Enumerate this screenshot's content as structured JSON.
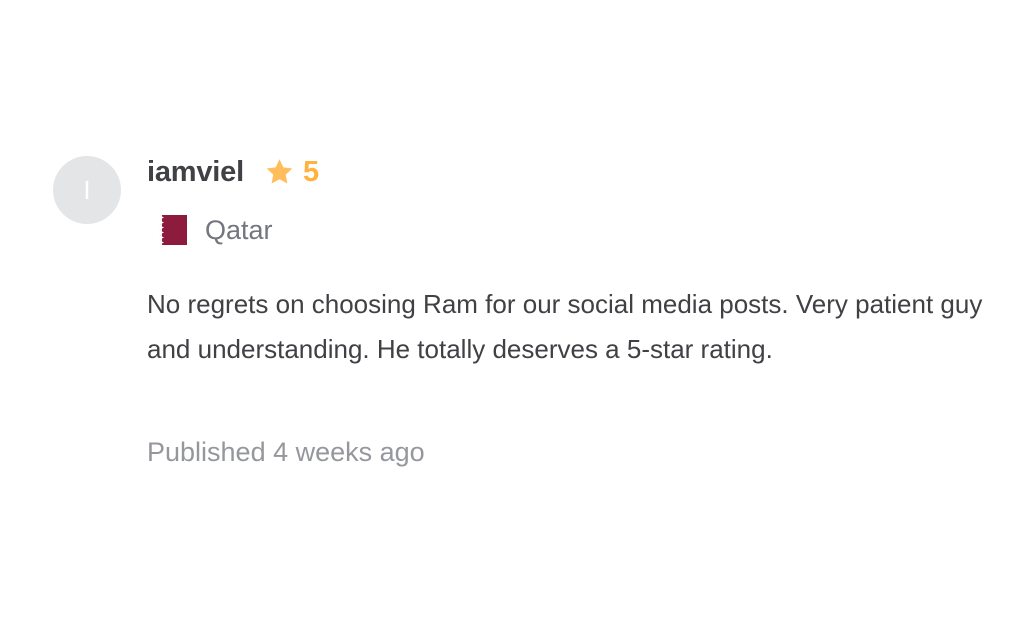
{
  "review": {
    "avatar_initial": "I",
    "username": "iamviel",
    "rating": "5",
    "rating_icon": "star-icon",
    "country": "Qatar",
    "country_flag_icon": "qatar-flag-icon",
    "text": "No regrets on choosing Ram for our social media posts. Very patient guy and understanding. He totally deserves a 5-star rating.",
    "published": "Published 4 weeks ago"
  },
  "colors": {
    "star": "#ffbe5b",
    "rating_text": "#ffb33e",
    "flag_maroon": "#8d1b3d",
    "avatar_bg": "#e4e5e7"
  }
}
